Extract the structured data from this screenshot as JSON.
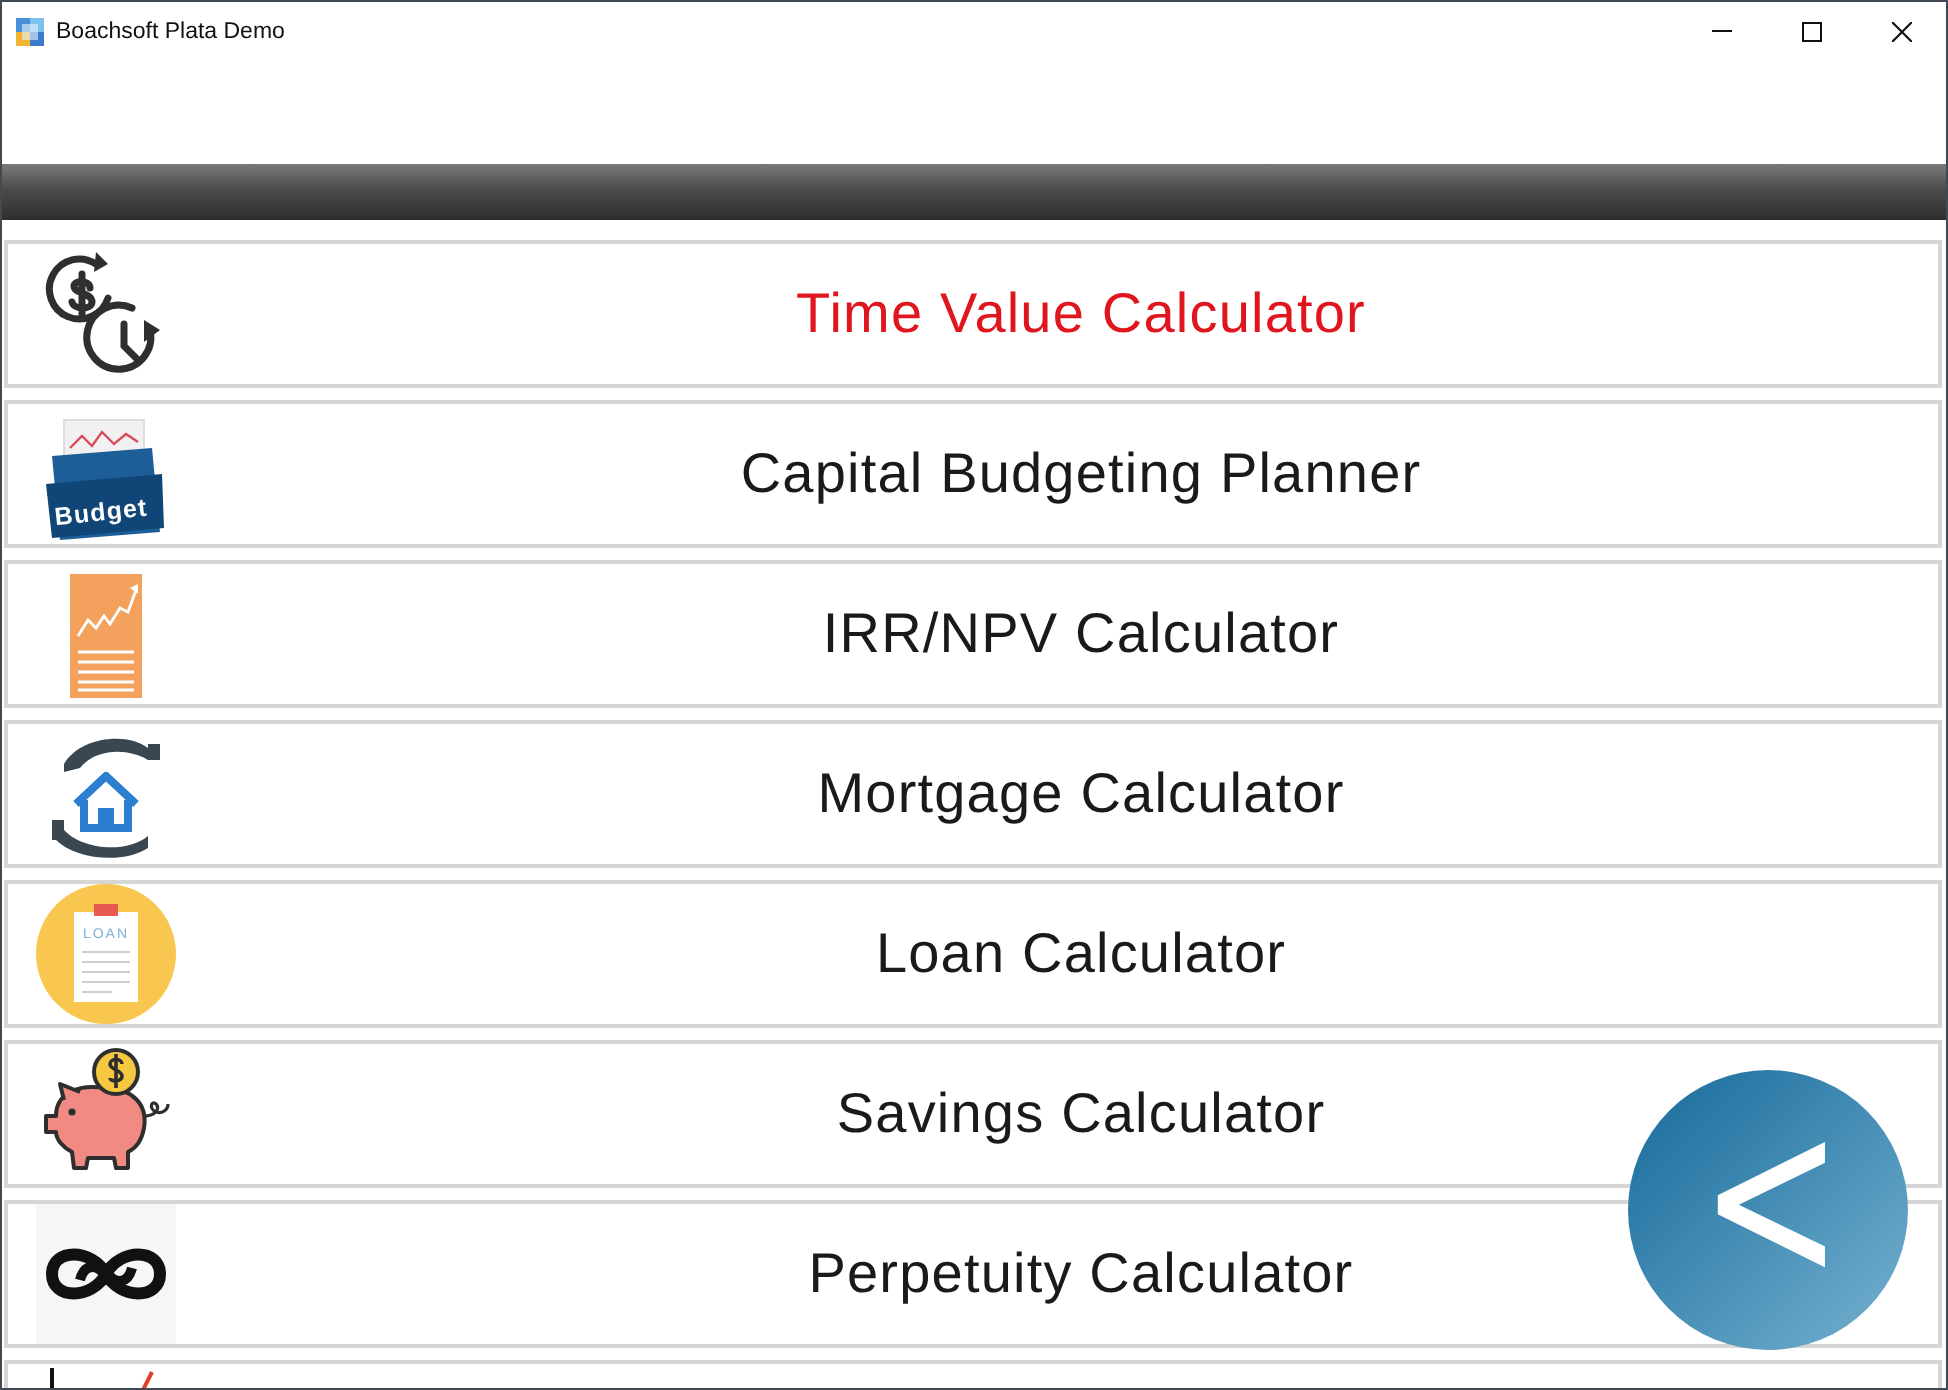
{
  "window": {
    "title": "Boachsoft Plata Demo"
  },
  "menu": [
    {
      "label": "Time Value Calculator",
      "kind": "clock",
      "selected": true
    },
    {
      "label": "Capital Budgeting Planner",
      "kind": "folder",
      "icon_text": "Budget",
      "selected": false
    },
    {
      "label": "IRR/NPV Calculator",
      "kind": "document",
      "selected": false
    },
    {
      "label": "Mortgage Calculator",
      "kind": "house",
      "selected": false
    },
    {
      "label": "Loan Calculator",
      "kind": "clipboard",
      "icon_text": "LOAN",
      "selected": false
    },
    {
      "label": "Savings Calculator",
      "kind": "piggy",
      "selected": false
    },
    {
      "label": "Perpetuity Calculator",
      "kind": "infinity",
      "selected": false
    },
    {
      "kind": "chart"
    }
  ],
  "back_button": {
    "label": "<"
  }
}
